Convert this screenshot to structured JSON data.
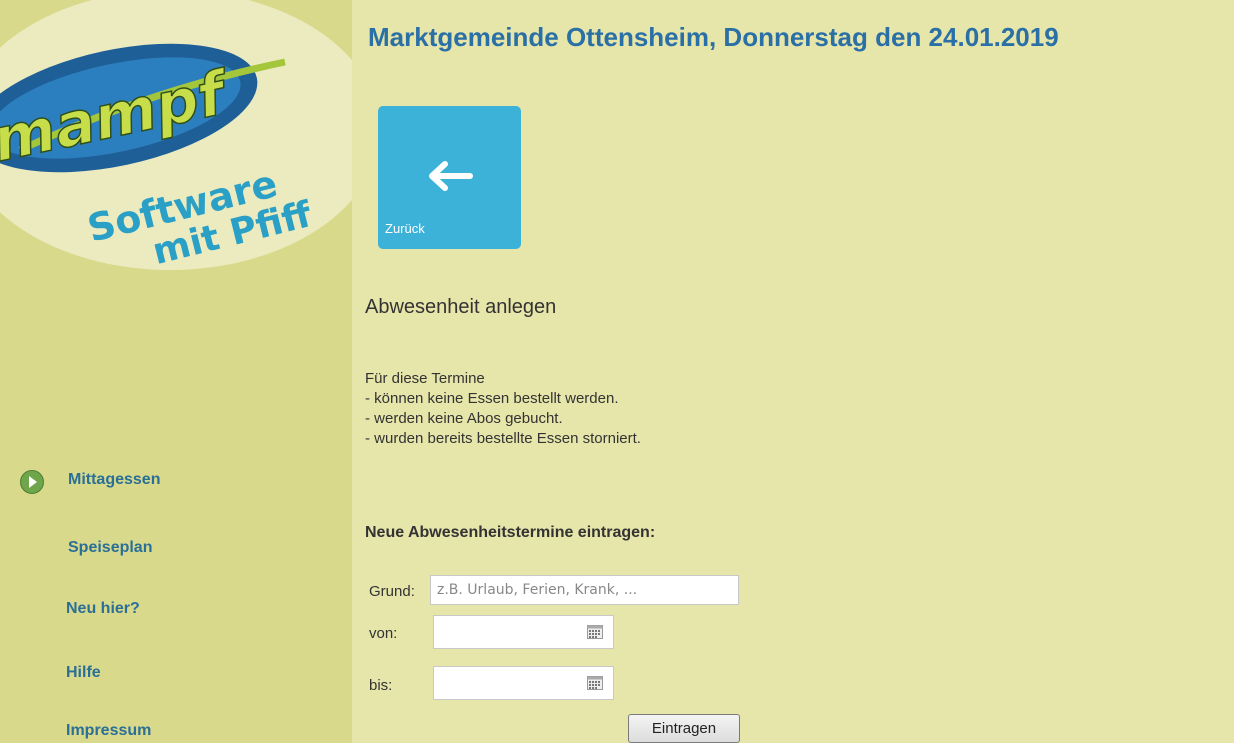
{
  "logo": {
    "brand": "mampf",
    "tagline_line1": "Software",
    "tagline_line2": "mit Pfiff"
  },
  "sidebar": {
    "items": [
      {
        "label": "Mittagessen",
        "active": true
      },
      {
        "label": "Speiseplan"
      },
      {
        "label": "Neu hier?"
      },
      {
        "label": "Hilfe"
      },
      {
        "label": "Impressum"
      }
    ]
  },
  "header": {
    "title": "Marktgemeinde Ottensheim, Donnerstag den 24.01.2019"
  },
  "back_tile": {
    "label": "Zurück",
    "icon": "arrow-left-icon",
    "color": "#3db2d9"
  },
  "main": {
    "section_title": "Abwesenheit anlegen",
    "info_lines": [
      "Für diese Termine",
      "- können keine Essen bestellt werden.",
      "- werden keine Abos gebucht.",
      "- wurden bereits bestellte Essen storniert."
    ],
    "form_heading": "Neue Abwesenheitstermine eintragen:"
  },
  "form": {
    "reason_label": "Grund:",
    "reason_placeholder": "z.B. Urlaub, Ferien, Krank, ...",
    "reason_value": "",
    "from_label": "von:",
    "from_value": "",
    "to_label": "bis:",
    "to_value": "",
    "submit_label": "Eintragen"
  },
  "colors": {
    "background": "#e6e5aa",
    "sidebar": "#d9d98c",
    "title": "#2a70a6",
    "nav_link": "#2a6f96"
  }
}
